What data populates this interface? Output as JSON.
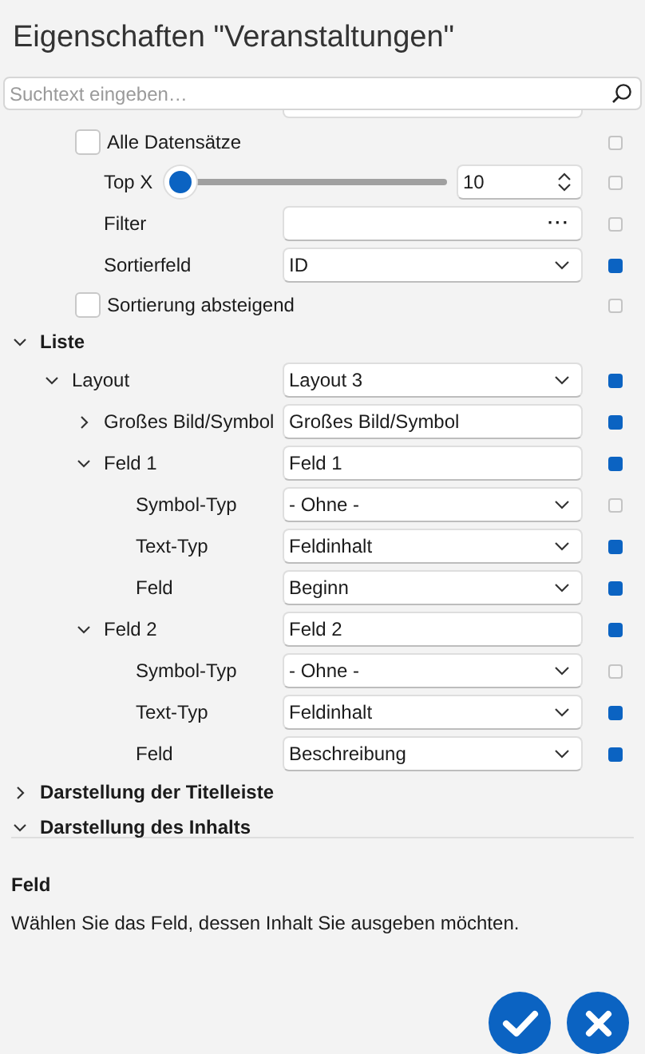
{
  "window": {
    "title": "Eigenschaften \"Veranstaltungen\""
  },
  "search": {
    "placeholder": "Suchtext eingeben…"
  },
  "scrolled_rows": [
    {
      "kind": "checkbox",
      "label": "Alle Datensätze",
      "checked": false,
      "modified": false
    },
    {
      "kind": "slider",
      "label": "Top X",
      "level": 0,
      "value": "10",
      "modified": false
    },
    {
      "kind": "picker",
      "label": "Filter",
      "value": "",
      "button": "···",
      "modified": false
    },
    {
      "kind": "dropdown",
      "label": "Sortierfeld",
      "value": "ID",
      "modified": true
    },
    {
      "kind": "checkbox",
      "label": "Sortierung absteigend",
      "checked": false,
      "modified": false
    }
  ],
  "tree": [
    {
      "kind": "heading",
      "label": "Liste",
      "expanded": true,
      "children": [
        {
          "kind": "dropdown",
          "label": "Layout",
          "value": "Layout 3",
          "modified": true,
          "expanded": true,
          "children": [
            {
              "kind": "text",
              "label": "Großes Bild/Symbol",
              "value": "Großes Bild/Symbol",
              "modified": true,
              "expanded": false
            },
            {
              "kind": "text",
              "label": "Feld 1",
              "value": "Feld 1",
              "modified": true,
              "expanded": true,
              "children": [
                {
                  "kind": "dropdown",
                  "label": "Symbol-Typ",
                  "value": "- Ohne -",
                  "modified": false
                },
                {
                  "kind": "dropdown",
                  "label": "Text-Typ",
                  "value": "Feldinhalt",
                  "modified": true
                },
                {
                  "kind": "dropdown",
                  "label": "Feld",
                  "value": "Beginn",
                  "modified": true
                }
              ]
            },
            {
              "kind": "text",
              "label": "Feld 2",
              "value": "Feld 2",
              "modified": true,
              "expanded": true,
              "children": [
                {
                  "kind": "dropdown",
                  "label": "Symbol-Typ",
                  "value": "- Ohne -",
                  "modified": false
                },
                {
                  "kind": "dropdown",
                  "label": "Text-Typ",
                  "value": "Feldinhalt",
                  "modified": true
                },
                {
                  "kind": "dropdown",
                  "label": "Feld",
                  "value": "Beschreibung",
                  "modified": true
                }
              ]
            }
          ]
        }
      ]
    },
    {
      "kind": "heading",
      "label": "Darstellung der Titelleiste",
      "expanded": false
    },
    {
      "kind": "heading",
      "label": "Darstellung des Inhalts",
      "expanded": true
    }
  ],
  "info": {
    "title": "Feld",
    "description": "Wählen Sie das Feld, dessen Inhalt Sie ausgeben möchten."
  }
}
